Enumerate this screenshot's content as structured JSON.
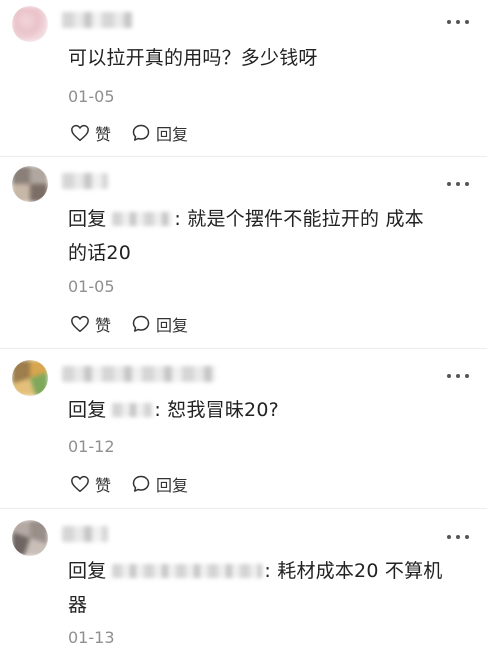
{
  "comments": [
    {
      "text": "可以拉开真的用吗？多少钱呀",
      "date": "01-05",
      "like_label": "赞",
      "reply_label": "回复"
    },
    {
      "reply_prefix": "回复",
      "text": ": 就是个摆件不能拉开的 成本的话20",
      "text_line1": ": 就是个摆件不能拉开的 成本",
      "text_line2": "的话20",
      "date": "01-05",
      "like_label": "赞",
      "reply_label": "回复"
    },
    {
      "reply_prefix": "回复",
      "text": ": 恕我冒昧20?",
      "date": "01-12",
      "like_label": "赞",
      "reply_label": "回复"
    },
    {
      "reply_prefix": "回复",
      "text": ": 耗材成本20 不算机器",
      "text_line1": ": 耗材成本20 不算机",
      "text_line2": "器",
      "date": "01-13"
    }
  ],
  "colors": {
    "text": "#222222",
    "meta": "#8f8f8f",
    "icon": "#333333"
  }
}
